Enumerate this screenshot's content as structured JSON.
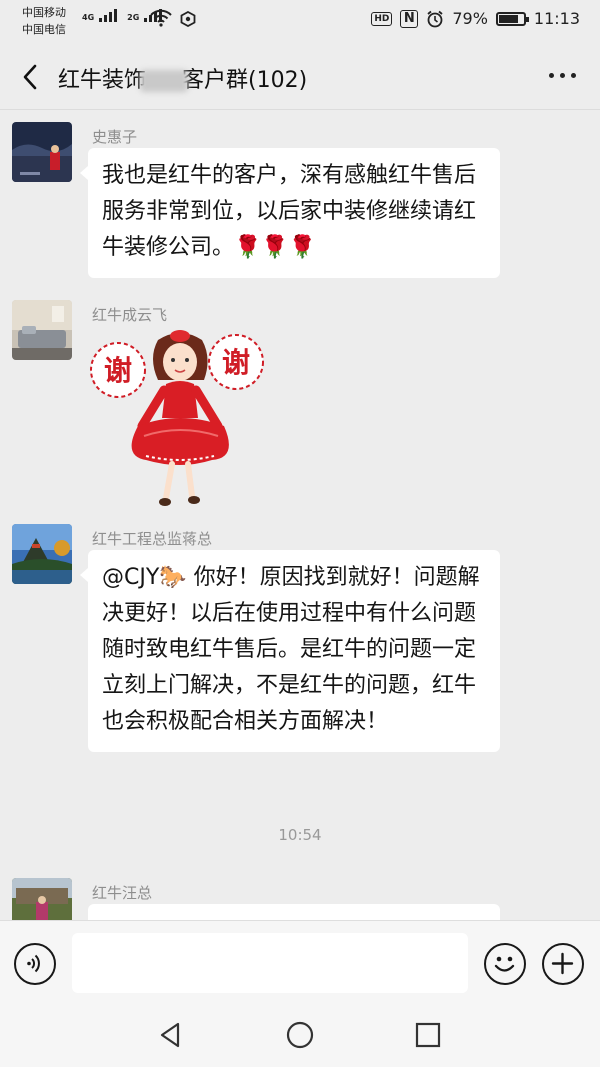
{
  "status": {
    "carrier1": "中国移动",
    "carrier2": "中国电信",
    "net1": "4G",
    "net2": "2G",
    "hd": "HD",
    "nfc": "N",
    "battery_text": "79%",
    "battery_level": 0.79,
    "time": "11:13"
  },
  "header": {
    "title_part1": "红牛装饰",
    "title_part2": "客户群(102)"
  },
  "messages": [
    {
      "sender": "史惠子",
      "text": "我也是红牛的客户，深有感触红牛售后服务非常到位，以后家中装修继续请红牛装修公司。🌹🌹🌹"
    },
    {
      "sender": "红牛成云飞",
      "sticker_left": "谢",
      "sticker_right": "谢"
    },
    {
      "sender": "红牛工程总监蒋总",
      "text": "@CJY🐎 你好！原因找到就好！问题解决更好！以后在使用过程中有什么问题随时致电红牛售后。是红牛的问题一定立刻上门解决，不是红牛的问题，红牛也会积极配合相关方面解决！"
    },
    {
      "sender": "红牛汪总"
    }
  ],
  "timestamp": "10:54",
  "input": {
    "placeholder": ""
  },
  "icons": {
    "back": "chevron-left-icon",
    "more": "more-dots-icon",
    "voice": "voice-icon",
    "emoji": "emoji-icon",
    "plus": "plus-icon"
  }
}
